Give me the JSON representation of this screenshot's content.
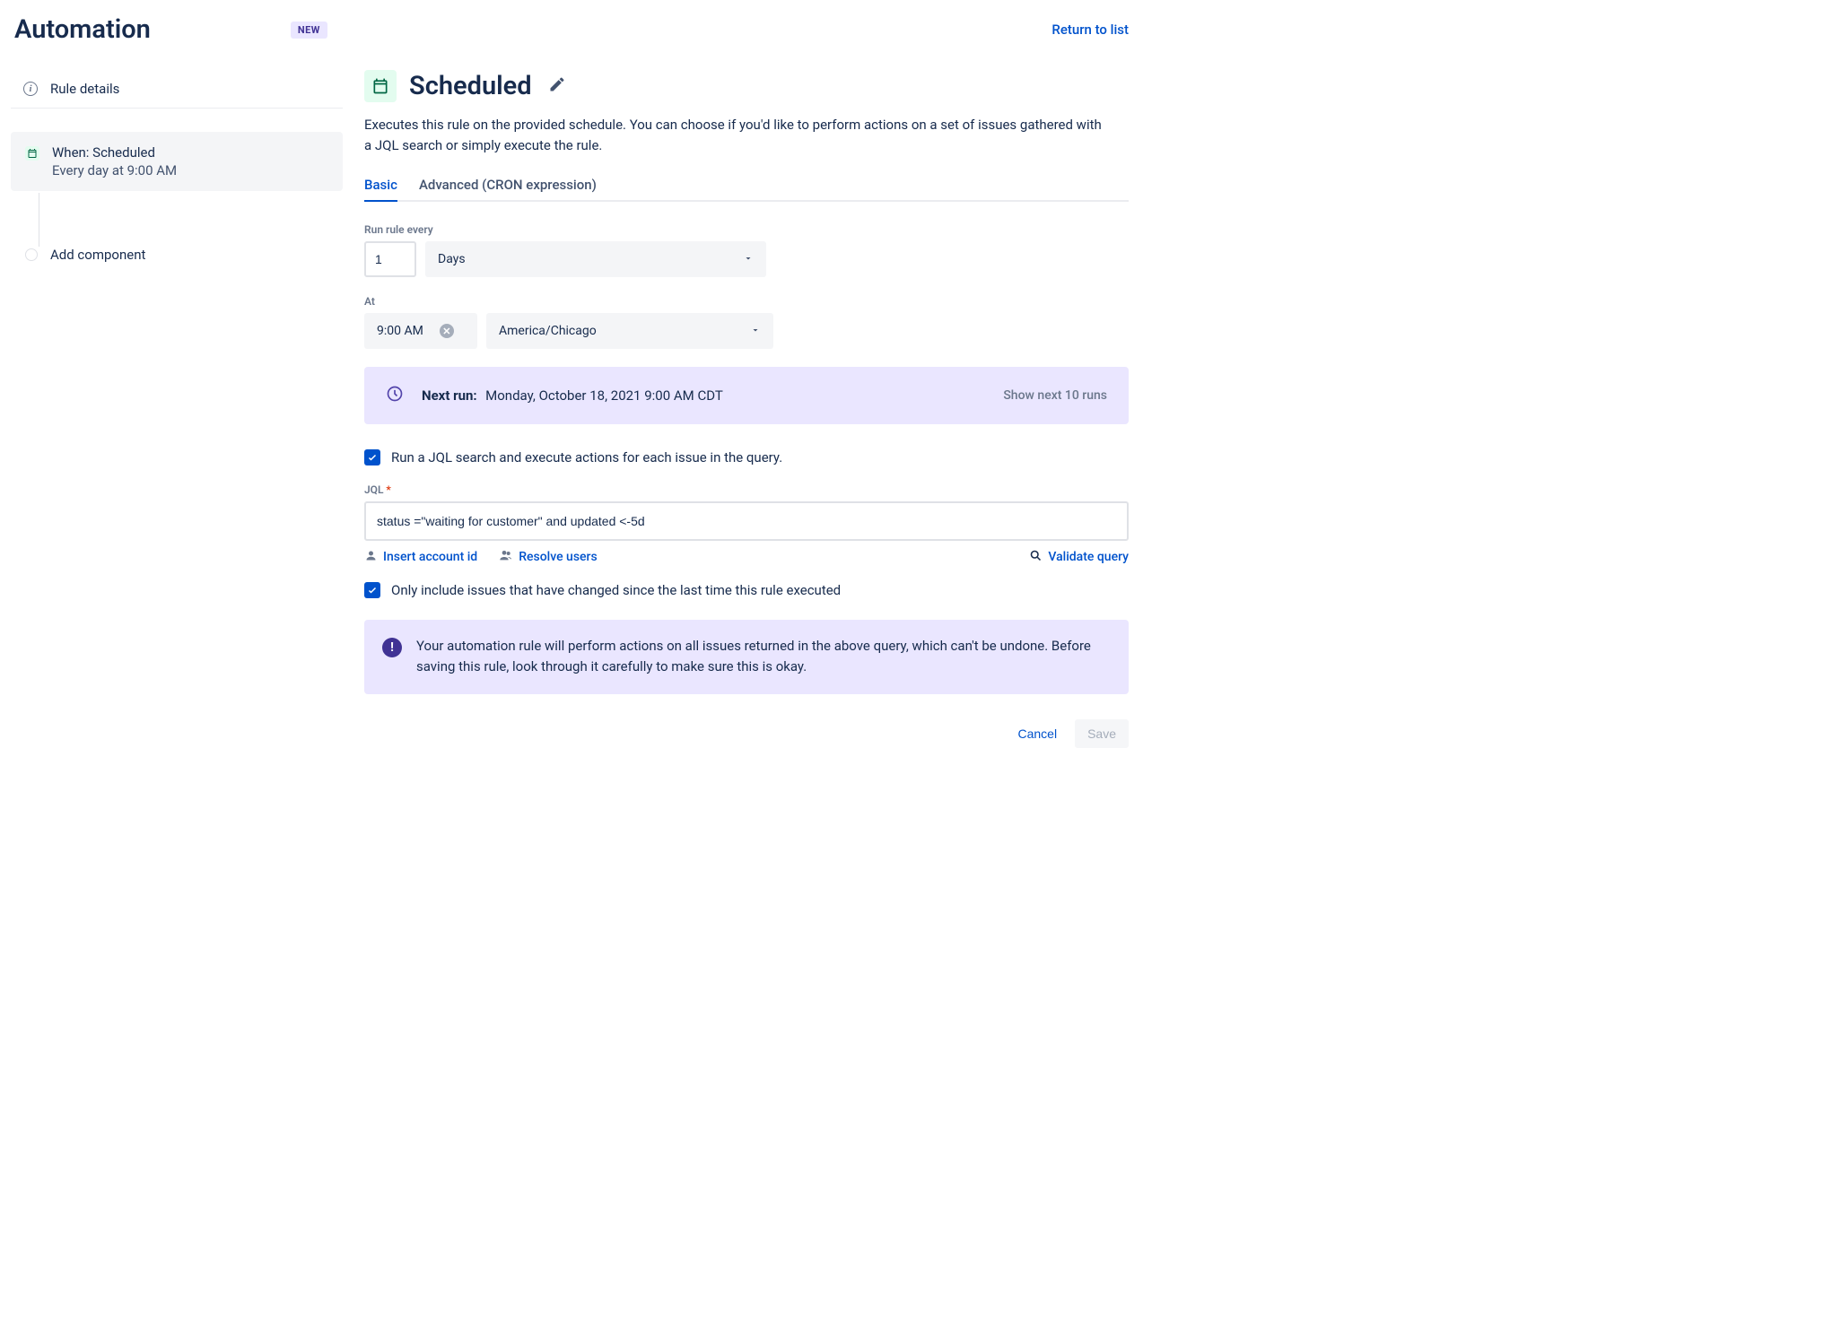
{
  "header": {
    "title": "Automation",
    "badge": "NEW",
    "return_link": "Return to list"
  },
  "sidebar": {
    "rule_details": "Rule details",
    "trigger_title": "When: Scheduled",
    "trigger_sub": "Every day at 9:00 AM",
    "add_component": "Add component"
  },
  "main": {
    "title": "Scheduled",
    "description": "Executes this rule on the provided schedule. You can choose if you'd like to perform actions on a set of issues gathered with a JQL search or simply execute the rule.",
    "tabs": {
      "basic": "Basic",
      "advanced": "Advanced (CRON expression)"
    },
    "form": {
      "run_every_label": "Run rule every",
      "interval_value": "1",
      "unit": "Days",
      "at_label": "At",
      "time": "9:00 AM",
      "timezone": "America/Chicago"
    },
    "next_run": {
      "label": "Next run:",
      "value": "Monday, October 18, 2021 9:00 AM CDT",
      "show_link": "Show next 10 runs"
    },
    "jql_checkbox": "Run a JQL search and execute actions for each issue in the query.",
    "jql_label": "JQL",
    "jql_value": "status =\"waiting for customer\" and updated <-5d",
    "insert_account": "Insert account id",
    "resolve_users": "Resolve users",
    "validate_query": "Validate query",
    "only_changed": "Only include issues that have changed since the last time this rule executed",
    "warning": "Your automation rule will perform actions on all issues returned in the above query, which can't be undone. Before saving this rule, look through it carefully to make sure this is okay.",
    "cancel": "Cancel",
    "save": "Save"
  }
}
